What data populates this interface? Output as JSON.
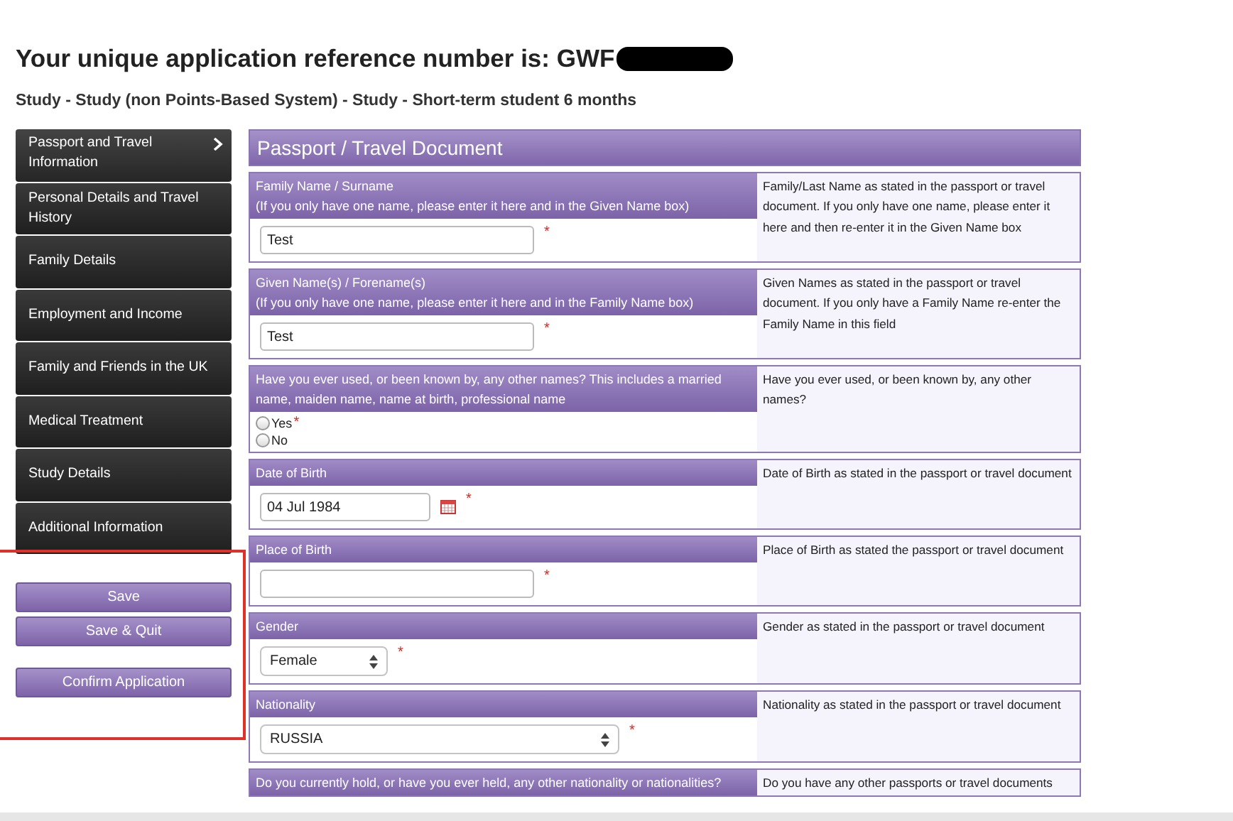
{
  "heading": {
    "text": "Your unique application reference number is: GWF",
    "redacted": true
  },
  "subtitle": "Study - Study (non Points-Based System) - Study - Short-term student 6 months",
  "sidebar": {
    "items": [
      {
        "label": "Passport and Travel Information",
        "selected": true
      },
      {
        "label": "Personal Details and Travel History",
        "selected": false
      },
      {
        "label": "Family Details",
        "selected": false
      },
      {
        "label": "Employment and Income",
        "selected": false
      },
      {
        "label": "Family and Friends in the UK",
        "selected": false
      },
      {
        "label": "Medical Treatment",
        "selected": false
      },
      {
        "label": "Study Details",
        "selected": false
      },
      {
        "label": "Additional Information",
        "selected": false
      }
    ],
    "buttons": [
      {
        "label": "Save",
        "kind": "primary"
      },
      {
        "label": "Save & Quit",
        "kind": "primary"
      },
      {
        "label": "Confirm Application",
        "kind": "spaced"
      }
    ],
    "highlighted": true
  },
  "section": {
    "title": "Passport / Travel Document",
    "fields": [
      {
        "kind": "text",
        "label": "Family Name / Surname",
        "note": "(If you only have one name, please enter it here and in the Given Name box)",
        "value": "Test",
        "required_mark": "*",
        "help": "Family/Last Name as stated in the passport or travel document. If you only have one name, please enter it here and then re-enter it in the Given Name box"
      },
      {
        "kind": "text",
        "label": "Given Name(s) / Forename(s)",
        "note": "(If you only have one name, please enter it here and in the Family Name box)",
        "value": "Test",
        "required_mark": "*",
        "help": "Given Names as stated in the passport or travel document. If you only have a Family Name re-enter the Family Name in this field"
      },
      {
        "kind": "radio",
        "label": "Have you ever used, or been known by, any other names? This includes a married name, maiden name, name at birth, professional name",
        "required_mark": "*",
        "options": [
          {
            "label": "Yes",
            "selected": false
          },
          {
            "label": "No",
            "selected": false
          }
        ],
        "help": "Have you ever used, or been known by, any other names?"
      },
      {
        "kind": "date",
        "label": "Date of Birth",
        "value": "04 Jul 1984",
        "required_mark": "*",
        "help": "Date of Birth as stated in the passport or travel document"
      },
      {
        "kind": "text",
        "label": "Place of Birth",
        "required_mark": "*",
        "help": "Place of Birth as stated the passport or travel document"
      },
      {
        "kind": "short-select",
        "label": "Gender",
        "value": "Female",
        "required_mark": "*",
        "help": "Gender as stated in the passport or travel document"
      },
      {
        "kind": "long-select",
        "label": "Nationality",
        "value": "RUSSIA",
        "required_mark": "*",
        "help": "Nationality as stated in the passport or travel document"
      },
      {
        "kind": "cut",
        "label": "Do you currently hold, or have you ever held, any other nationality or nationalities?",
        "help": "Do you have any other passports or travel documents"
      }
    ]
  }
}
